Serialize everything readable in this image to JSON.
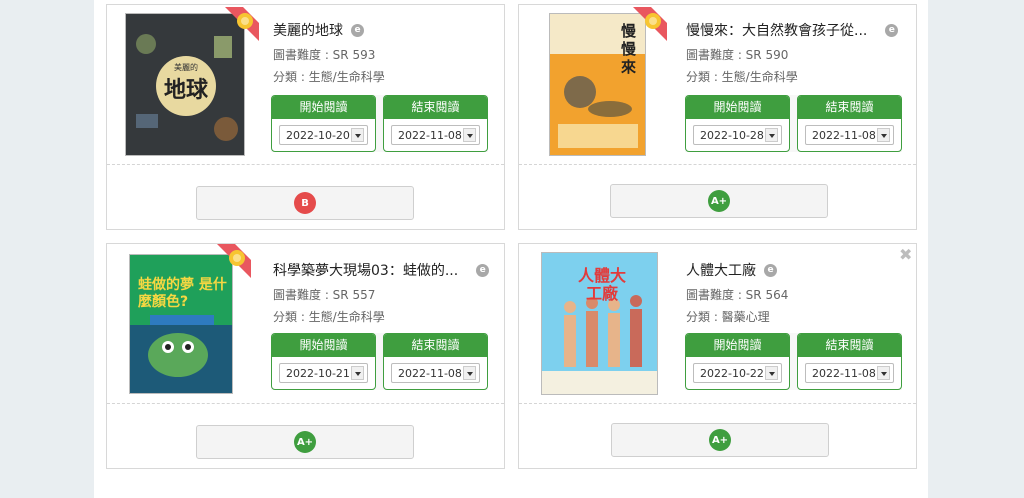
{
  "labels": {
    "start": "開始閱讀",
    "end": "結束閱讀"
  },
  "colors": {
    "green": "#3f9e3f",
    "grade_red": "#e54b4b",
    "grade_green": "#3f9e3f"
  },
  "books": [
    {
      "title": "美麗的地球",
      "level": "圖書難度 : SR 593",
      "category": "分類 : 生態/生命科學",
      "start_date": "2022-10-20",
      "end_date": "2022-11-08",
      "grade": "B",
      "grade_color": "#e54b4b",
      "cover_title": "地球",
      "cover_top": "美麗的",
      "ebook_badge": "e"
    },
    {
      "title": "慢慢來：大自然教會孩子從...",
      "level": "圖書難度 : SR 590",
      "category": "分類 : 生態/生命科學",
      "start_date": "2022-10-28",
      "end_date": "2022-11-08",
      "grade": "A+",
      "grade_color": "#3f9e3f",
      "cover_title": "慢慢來",
      "ebook_badge": "e"
    },
    {
      "title": "科學築夢大現場03：蛙做的...",
      "level": "圖書難度 : SR 557",
      "category": "分類 : 生態/生命科學",
      "start_date": "2022-10-21",
      "end_date": "2022-11-08",
      "grade": "A+",
      "grade_color": "#3f9e3f",
      "cover_title": "蛙做的夢 是什麼顏色?",
      "ebook_badge": "e"
    },
    {
      "title": "人體大工廠",
      "level": "圖書難度 : SR 564",
      "category": "分類 : 醫藥心理",
      "start_date": "2022-10-22",
      "end_date": "2022-11-08",
      "grade": "A+",
      "grade_color": "#3f9e3f",
      "cover_title": "人體大工廠",
      "ebook_badge": "e"
    }
  ]
}
